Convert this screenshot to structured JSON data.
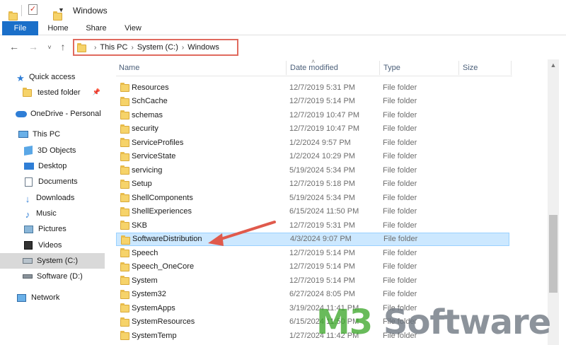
{
  "window": {
    "title": "Windows"
  },
  "ribbon": {
    "tabs": [
      "File",
      "Home",
      "Share",
      "View"
    ]
  },
  "address": {
    "crumbs": [
      "This PC",
      "System (C:)",
      "Windows"
    ]
  },
  "sidebar": {
    "items": [
      {
        "label": "Quick access",
        "icon": "star-icon"
      },
      {
        "label": "tested folder",
        "icon": "folder-icon"
      },
      {
        "label": "OneDrive - Personal",
        "icon": "cloud-icon"
      },
      {
        "label": "This PC",
        "icon": "computer-icon"
      },
      {
        "label": "3D Objects",
        "icon": "cube-icon"
      },
      {
        "label": "Desktop",
        "icon": "desktop-icon"
      },
      {
        "label": "Documents",
        "icon": "document-icon"
      },
      {
        "label": "Downloads",
        "icon": "download-icon"
      },
      {
        "label": "Music",
        "icon": "music-icon"
      },
      {
        "label": "Pictures",
        "icon": "picture-icon"
      },
      {
        "label": "Videos",
        "icon": "video-icon"
      },
      {
        "label": "System (C:)",
        "icon": "drive-icon"
      },
      {
        "label": "Software (D:)",
        "icon": "drive-icon"
      },
      {
        "label": "Network",
        "icon": "network-icon"
      }
    ]
  },
  "columns": {
    "name": "Name",
    "date": "Date modified",
    "type": "Type",
    "size": "Size"
  },
  "files": [
    {
      "name": "Resources",
      "date": "12/7/2019 5:31 PM",
      "type": "File folder"
    },
    {
      "name": "SchCache",
      "date": "12/7/2019 5:14 PM",
      "type": "File folder"
    },
    {
      "name": "schemas",
      "date": "12/7/2019 10:47 PM",
      "type": "File folder"
    },
    {
      "name": "security",
      "date": "12/7/2019 10:47 PM",
      "type": "File folder"
    },
    {
      "name": "ServiceProfiles",
      "date": "1/2/2024 9:57 PM",
      "type": "File folder"
    },
    {
      "name": "ServiceState",
      "date": "1/2/2024 10:29 PM",
      "type": "File folder"
    },
    {
      "name": "servicing",
      "date": "5/19/2024 5:34 PM",
      "type": "File folder"
    },
    {
      "name": "Setup",
      "date": "12/7/2019 5:18 PM",
      "type": "File folder"
    },
    {
      "name": "ShellComponents",
      "date": "5/19/2024 5:34 PM",
      "type": "File folder"
    },
    {
      "name": "ShellExperiences",
      "date": "6/15/2024 11:50 PM",
      "type": "File folder"
    },
    {
      "name": "SKB",
      "date": "12/7/2019 5:31 PM",
      "type": "File folder"
    },
    {
      "name": "SoftwareDistribution",
      "date": "4/3/2024 9:07 PM",
      "type": "File folder"
    },
    {
      "name": "Speech",
      "date": "12/7/2019 5:14 PM",
      "type": "File folder"
    },
    {
      "name": "Speech_OneCore",
      "date": "12/7/2019 5:14 PM",
      "type": "File folder"
    },
    {
      "name": "System",
      "date": "12/7/2019 5:14 PM",
      "type": "File folder"
    },
    {
      "name": "System32",
      "date": "6/27/2024 8:05 PM",
      "type": "File folder"
    },
    {
      "name": "SystemApps",
      "date": "3/19/2024 11:41 PM",
      "type": "File folder"
    },
    {
      "name": "SystemResources",
      "date": "6/15/2024 11:50 PM",
      "type": "File folder"
    },
    {
      "name": "SystemTemp",
      "date": "1/27/2024 11:42 PM",
      "type": "File folder"
    }
  ],
  "watermark": {
    "brand": "M3",
    "suffix": " Software"
  },
  "colors": {
    "accent": "#1a6fc9",
    "highlight": "#e06a5e",
    "selection": "#cce8ff"
  }
}
